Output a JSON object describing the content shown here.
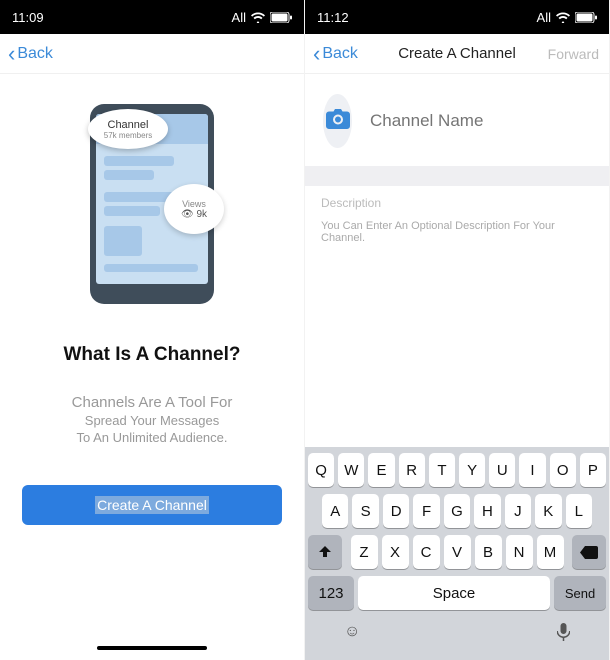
{
  "screen1": {
    "status": {
      "time": "11:09",
      "carrier": "All"
    },
    "nav": {
      "back": "Back"
    },
    "graphic": {
      "channel_label": "Channel",
      "members": "57k members",
      "views_label": "Views",
      "views_count": "9k"
    },
    "title": "What Is A Channel?",
    "line1": "Channels Are A Tool For",
    "line2": "Spread Your Messages",
    "line3": "To An Unlimited Audience.",
    "button": "Create A Channel"
  },
  "screen2": {
    "status": {
      "time": "11:12",
      "carrier": "All"
    },
    "nav": {
      "back": "Back",
      "title": "Create A Channel",
      "forward": "Forward"
    },
    "name_placeholder": "Channel Name",
    "desc_label": "Description",
    "desc_placeholder": "You Can Enter An Optional Description For Your Channel.",
    "keyboard": {
      "row1": [
        "Q",
        "W",
        "E",
        "R",
        "T",
        "Y",
        "U",
        "I",
        "O",
        "P"
      ],
      "row2": [
        "A",
        "S",
        "D",
        "F",
        "G",
        "H",
        "J",
        "K",
        "L"
      ],
      "row3": [
        "Z",
        "X",
        "C",
        "V",
        "B",
        "N",
        "M"
      ],
      "k123": "123",
      "space": "Space",
      "send": "Send"
    }
  }
}
